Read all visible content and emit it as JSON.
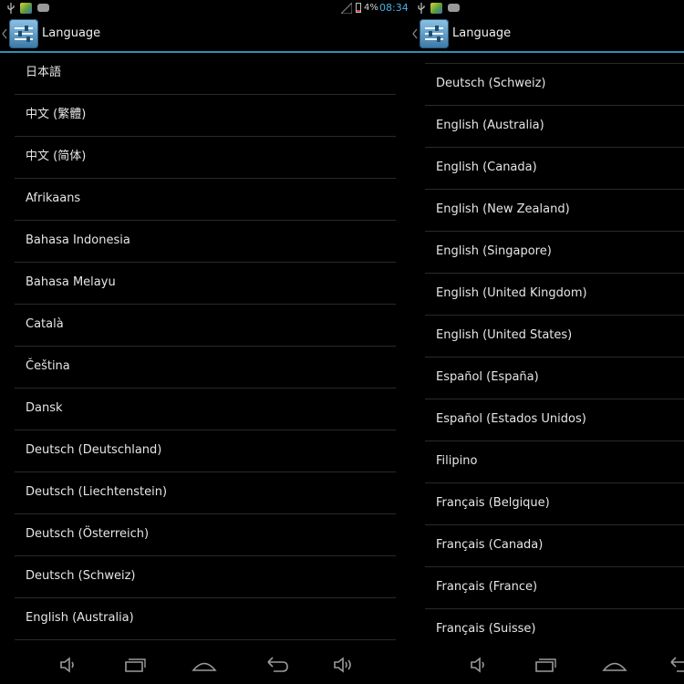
{
  "status_bar": {
    "battery_percent": "4%",
    "time": "08:34"
  },
  "left_screen": {
    "action_bar": {
      "title": "Language"
    },
    "languages": [
      "日本語",
      "中文 (繁體)",
      "中文 (简体)",
      "Afrikaans",
      "Bahasa Indonesia",
      "Bahasa Melayu",
      "Català",
      "Čeština",
      "Dansk",
      "Deutsch (Deutschland)",
      "Deutsch (Liechtenstein)",
      "Deutsch (Österreich)",
      "Deutsch (Schweiz)",
      "English (Australia)"
    ]
  },
  "right_screen": {
    "action_bar": {
      "title": "Language"
    },
    "languages": [
      "Deutsch (Schweiz)",
      "English (Australia)",
      "English (Canada)",
      "English (New Zealand)",
      "English (Singapore)",
      "English (United Kingdom)",
      "English (United States)",
      "Español (España)",
      "Español (Estados Unidos)",
      "Filipino",
      "Français (Belgique)",
      "Français (Canada)",
      "Français (France)",
      "Français (Suisse)"
    ]
  },
  "nav_bar": {
    "buttons": [
      "volume-down-icon",
      "recent-apps-icon",
      "home-icon",
      "back-icon",
      "volume-up-icon"
    ]
  },
  "colors": {
    "accent": "#2d8fb5",
    "clock": "#4ab0e0",
    "background": "#000000",
    "divider": "#2a2a2a",
    "text": "#e6e6e6"
  }
}
